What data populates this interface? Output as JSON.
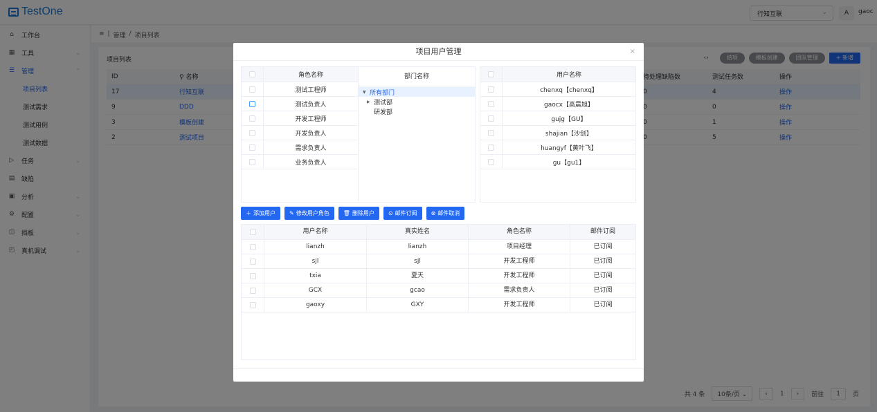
{
  "app": {
    "logo": "TestOne",
    "org_select": "行知互联",
    "lang_icon": "A",
    "user": "gaoc"
  },
  "sidebar": {
    "items": [
      {
        "label": "工作台",
        "icon": "home-icon"
      },
      {
        "label": "工具",
        "icon": "grid-icon"
      },
      {
        "label": "管理",
        "icon": "list-icon"
      },
      {
        "label": "任务",
        "icon": "play-icon"
      },
      {
        "label": "缺陷",
        "icon": "doc-icon"
      },
      {
        "label": "分析",
        "icon": "calendar-icon"
      },
      {
        "label": "配置",
        "icon": "gear-icon"
      },
      {
        "label": "挡板",
        "icon": "panel-icon"
      },
      {
        "label": "真机调试",
        "icon": "device-icon"
      }
    ],
    "sub_items": [
      "项目列表",
      "测试需求",
      "测试用例",
      "测试数据"
    ]
  },
  "breadcrumb": {
    "root": "管理",
    "sep": "/",
    "current": "项目列表"
  },
  "main": {
    "title": "项目列表",
    "buttons": {
      "finish": "结项",
      "template_create": "模板创建",
      "team_manage": "团队管理",
      "new": "+ 新增"
    },
    "table": {
      "headers": [
        "ID",
        "名称",
        "待处理缺陷数",
        "测试任务数",
        "操作"
      ],
      "rows": [
        {
          "id": "17",
          "name": "行知互联",
          "defects": "0",
          "tasks": "4",
          "op": "操作"
        },
        {
          "id": "9",
          "name": "DDD",
          "defects": "0",
          "tasks": "0",
          "op": "操作"
        },
        {
          "id": "3",
          "name": "模板创建",
          "defects": "0",
          "tasks": "1",
          "op": "操作"
        },
        {
          "id": "2",
          "name": "测试项目",
          "defects": "0",
          "tasks": "5",
          "op": "操作"
        }
      ]
    },
    "pager": {
      "total": "共 4 条",
      "size": "10条/页",
      "page": "1",
      "goto_label": "前往",
      "goto_page": "1",
      "page_unit": "页"
    }
  },
  "modal": {
    "title": "项目用户管理",
    "roles": {
      "header": "角色名称",
      "items": [
        "测试工程师",
        "测试负责人",
        "开发工程师",
        "开发负责人",
        "需求负责人",
        "业务负责人"
      ]
    },
    "depts": {
      "header": "部门名称",
      "root": "所有部门",
      "children": [
        "测试部",
        "研发部"
      ]
    },
    "users": {
      "header": "用户名称",
      "items": [
        "chenxq【chenxq】",
        "gaocx【高晨旭】",
        "gujg【GU】",
        "shajian【沙剑】",
        "huangyf【黄叶飞】",
        "gu【gu1】"
      ]
    },
    "actions": {
      "add": "添加用户",
      "edit": "修改用户角色",
      "delete": "删除用户",
      "subscribe": "邮件订阅",
      "unsubscribe": "邮件取消"
    },
    "project_users": {
      "headers": [
        "用户名称",
        "真实姓名",
        "角色名称",
        "邮件订阅"
      ],
      "rows": [
        {
          "user": "lianzh",
          "real": "lianzh",
          "role": "项目经理",
          "sub": "已订阅"
        },
        {
          "user": "sjl",
          "real": "sjl",
          "role": "开发工程师",
          "sub": "已订阅"
        },
        {
          "user": "txia",
          "real": "夏天",
          "role": "开发工程师",
          "sub": "已订阅"
        },
        {
          "user": "GCX",
          "real": "gcao",
          "role": "需求负责人",
          "sub": "已订阅"
        },
        {
          "user": "gaoxy",
          "real": "GXY",
          "role": "开发工程师",
          "sub": "已订阅"
        }
      ]
    }
  }
}
